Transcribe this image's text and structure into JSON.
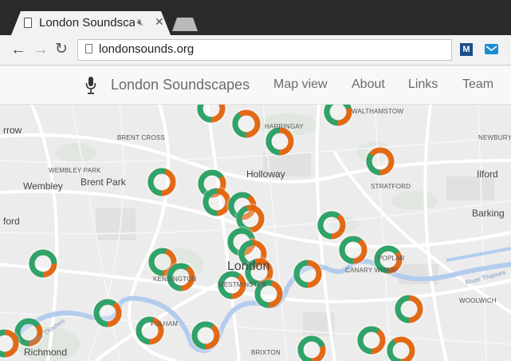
{
  "browser": {
    "tab_title": "London Soundscapes",
    "url": "londonsounds.org",
    "extension_m_label": "M"
  },
  "navbar": {
    "brand": "London Soundscapes",
    "links": [
      "Map view",
      "About",
      "Links",
      "Team"
    ]
  },
  "map": {
    "places": [
      "WALTHAMSTOW",
      "HARRINGAY",
      "rrow",
      "BRENT CROSS",
      "NEWBURY",
      "WEMBLEY PARK",
      "Holloway",
      "Wembley",
      "Brent Park",
      "Ilford",
      "STRATFORD",
      "Barking",
      "ford",
      "London",
      "KENSINGTON",
      "WESTMINSTER",
      "POPLAR",
      "CANARY WHARF",
      "WOOLWICH",
      "FULHAM",
      "River Thames",
      "Richmond",
      "BRIXTON",
      "River Thames"
    ],
    "colors": {
      "orange": "#e0620b",
      "green": "#2ea36a",
      "river": "#b3ccee",
      "road": "#ffffff",
      "park": "#dde8dd"
    }
  }
}
